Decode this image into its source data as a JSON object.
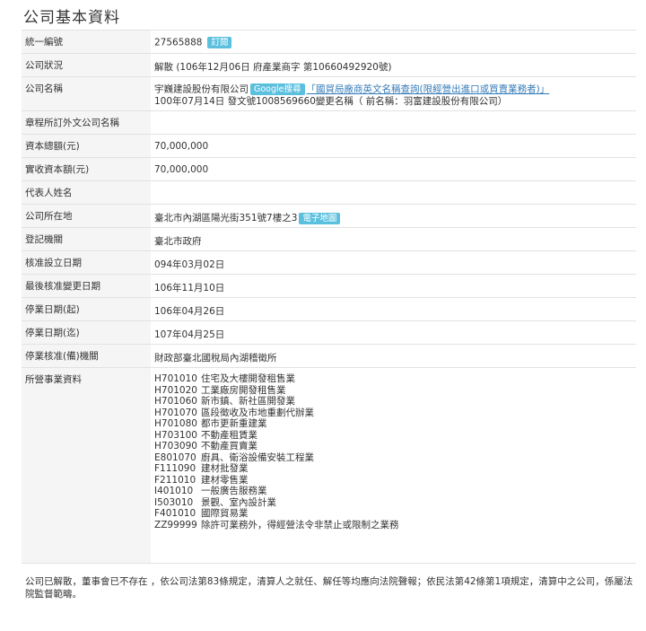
{
  "page_title": "公司基本資料",
  "rows": {
    "tax_id": {
      "label": "統一編號",
      "value": "27565888",
      "badge": "訂閱"
    },
    "status": {
      "label": "公司狀況",
      "value": "解散 (106年12月06日 府產業商字 第10660492920號)"
    },
    "name": {
      "label": "公司名稱",
      "value": "宇巍建設股份有限公司",
      "google_badge": "Google搜尋",
      "link_text": "「國貿局廠商英文名稱查詢(限經營出進口或買賣業務者)」",
      "line2": "100年07月14日 發文號1008569660變更名稱（ 前名稱：羽富建設股份有限公司）"
    },
    "foreign_name": {
      "label": "章程所訂外文公司名稱",
      "value": ""
    },
    "capital": {
      "label": "資本總額(元)",
      "value": "70,000,000"
    },
    "paid_capital": {
      "label": "實收資本額(元)",
      "value": "70,000,000"
    },
    "representative": {
      "label": "代表人姓名",
      "value": ""
    },
    "address": {
      "label": "公司所在地",
      "value": "臺北市內湖區陽光街351號7樓之3",
      "badge": "電子地圖"
    },
    "registrar": {
      "label": "登記機關",
      "value": "臺北市政府"
    },
    "approval_date": {
      "label": "核准設立日期",
      "value": "094年03月02日"
    },
    "last_change": {
      "label": "最後核准變更日期",
      "value": "106年11月10日"
    },
    "suspend_start": {
      "label": "停業日期(起)",
      "value": "106年04月26日"
    },
    "suspend_end": {
      "label": "停業日期(迄)",
      "value": "107年04月25日"
    },
    "suspend_agency": {
      "label": "停業核准(備)機關",
      "value": "財政部臺北國稅局內湖稽徵所"
    },
    "business": {
      "label": "所營事業資料"
    }
  },
  "business_items": [
    {
      "code": "H701010",
      "desc": "住宅及大樓開發租售業"
    },
    {
      "code": "H701020",
      "desc": "工業廠房開發租售業"
    },
    {
      "code": "H701060",
      "desc": "新市鎮、新社區開發業"
    },
    {
      "code": "H701070",
      "desc": "區段徵收及市地重劃代辦業"
    },
    {
      "code": "H701080",
      "desc": "都市更新重建業"
    },
    {
      "code": "H703100",
      "desc": "不動產租賃業"
    },
    {
      "code": "H703090",
      "desc": "不動產買賣業"
    },
    {
      "code": "E801070",
      "desc": "廚具、衛浴設備安裝工程業"
    },
    {
      "code": "F111090",
      "desc": "建材批發業"
    },
    {
      "code": "F211010",
      "desc": "建材零售業"
    },
    {
      "code": "I401010",
      "desc": "一般廣告服務業"
    },
    {
      "code": "I503010",
      "desc": "景觀、室內設計業"
    },
    {
      "code": "F401010",
      "desc": "國際貿易業"
    },
    {
      "code": "ZZ99999",
      "desc": "除許可業務外，得經營法令非禁止或限制之業務"
    }
  ],
  "footer": "公司已解散，董事會已不存在 ，依公司法第83條規定，清算人之就任、解任等均應向法院聲報；依民法第42條第1項規定，清算中之公司，係屬法院監督範疇。"
}
